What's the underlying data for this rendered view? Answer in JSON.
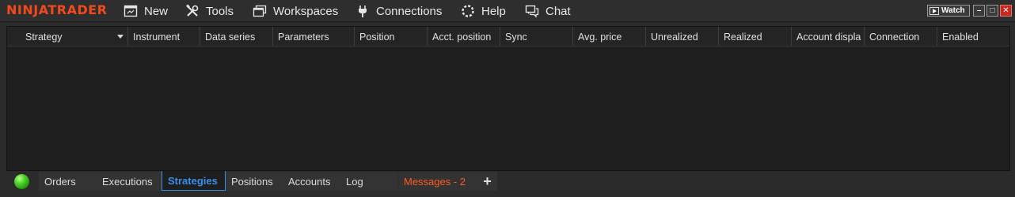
{
  "app": {
    "logo": "NINJATRADER"
  },
  "menu": {
    "items": [
      {
        "label": "New",
        "icon": "new-window-icon"
      },
      {
        "label": "Tools",
        "icon": "tools-icon"
      },
      {
        "label": "Workspaces",
        "icon": "workspaces-icon"
      },
      {
        "label": "Connections",
        "icon": "plug-icon"
      },
      {
        "label": "Help",
        "icon": "lifebuoy-icon"
      },
      {
        "label": "Chat",
        "icon": "chat-icon"
      }
    ]
  },
  "window_controls": {
    "watch_label": "Watch",
    "minimize": "–",
    "maximize": "□",
    "close": "✕"
  },
  "grid": {
    "columns": [
      "Strategy",
      "Instrument",
      "Data series",
      "Parameters",
      "Position",
      "Acct. position",
      "Sync",
      "Avg. price",
      "Unrealized",
      "Realized",
      "Account displa",
      "Connection",
      "Enabled"
    ],
    "rows": []
  },
  "tabs": {
    "items": [
      {
        "label": "Orders"
      },
      {
        "label": "Executions"
      },
      {
        "label": "Strategies",
        "active": true
      },
      {
        "label": "Positions"
      },
      {
        "label": "Accounts"
      },
      {
        "label": "Log"
      },
      {
        "label": "Messages - 2",
        "alert": true
      },
      {
        "label": "+"
      }
    ]
  },
  "colors": {
    "brand": "#f04a1c",
    "active_tab": "#3a8fe8",
    "alert": "#ff5a1f",
    "connection_status": "#4fd62a"
  }
}
